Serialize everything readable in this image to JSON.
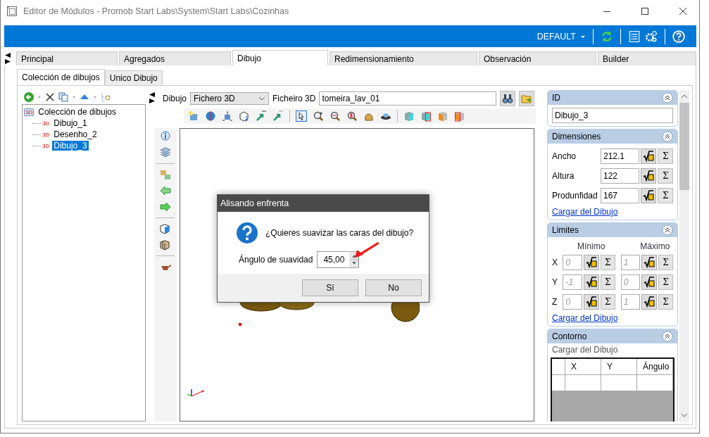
{
  "window": {
    "title": "Editor de Módulos - Promob Start Labs\\System\\Start Labs\\Cozinhas"
  },
  "ribbon": {
    "profile": "DEFAULT"
  },
  "tabs": [
    {
      "label": "Principal",
      "selected": false
    },
    {
      "label": "Agregados",
      "selected": false
    },
    {
      "label": "Dibujo",
      "selected": true
    },
    {
      "label": "Redimensionamiento",
      "selected": false
    },
    {
      "label": "Observación",
      "selected": false
    },
    {
      "label": "Builder",
      "selected": false
    }
  ],
  "subtabs": [
    {
      "label": "Colección de dibujos",
      "selected": true
    },
    {
      "label": "Unico Dibujo",
      "selected": false
    }
  ],
  "tree": {
    "label": "Colección de dibujos",
    "badge": "3D",
    "children": [
      {
        "label": "Dibujo_1",
        "badge": "3D",
        "selected": false
      },
      {
        "label": "Desenho_2",
        "badge": "3D",
        "selected": false
      },
      {
        "label": "Dibujo_3",
        "badge": "3D",
        "selected": true
      }
    ]
  },
  "drawing": {
    "type_label": "Dibujo",
    "type_value": "Fichero 3D",
    "file_label": "Ficheiro 3D",
    "file_value": "tomeira_lav_01"
  },
  "properties": {
    "id": {
      "title": "ID",
      "value": "Dibujo_3"
    },
    "dimensions": {
      "title": "Dimensiones",
      "rows": [
        {
          "label": "Ancho",
          "value": "212.1",
          "sum": "Σ"
        },
        {
          "label": "Altura",
          "value": "122",
          "sum": "Σ"
        },
        {
          "label": "Produnfidad",
          "value": "167",
          "sum": "Σ"
        }
      ],
      "link": "Cargar del Dibujo"
    },
    "limits": {
      "title": "Limites",
      "min_header": "Mínimo",
      "max_header": "Máximo",
      "rows": [
        {
          "axis": "X",
          "min": "0",
          "min_sum": "Σ",
          "max": "1",
          "max_sum": "Σ"
        },
        {
          "axis": "Y",
          "min": "-1",
          "min_sum": "Σ",
          "max": "0",
          "max_sum": "Σ"
        },
        {
          "axis": "Z",
          "min": "0",
          "min_sum": "Σ",
          "max": "1",
          "max_sum": "Σ"
        }
      ],
      "link": "Cargar del Dibujo"
    },
    "contour": {
      "title": "Contorno",
      "load_label": "Cargar del Dibujo",
      "columns": [
        "X",
        "Y",
        "Ángulo"
      ]
    }
  },
  "dialog": {
    "title": "Alisando enfrenta",
    "question": "¿Quieres suavizar las caras del dibujo?",
    "field_label": "Ángulo de suavidad",
    "field_value": "45,00",
    "buttons": [
      "Sí",
      "No"
    ]
  }
}
